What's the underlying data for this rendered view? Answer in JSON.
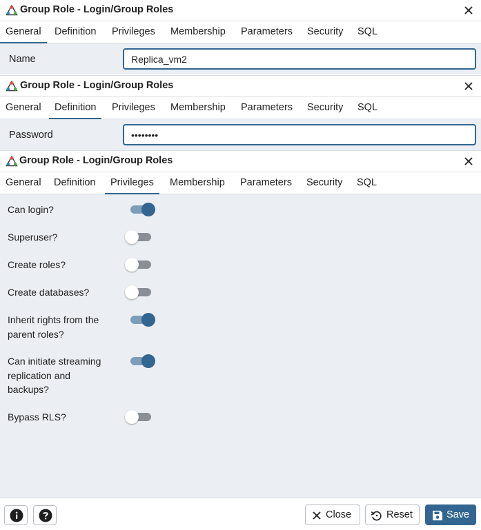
{
  "dialog_title": "Group Role - Login/Group Roles",
  "tabs": [
    "General",
    "Definition",
    "Privileges",
    "Membership",
    "Parameters",
    "Security",
    "SQL"
  ],
  "general": {
    "name_label": "Name",
    "name_value": "Replica_vm2"
  },
  "definition": {
    "password_label": "Password",
    "password_value": "••••••••"
  },
  "privileges": [
    {
      "label": "Can login?",
      "enabled": true
    },
    {
      "label": "Superuser?",
      "enabled": false
    },
    {
      "label": "Create roles?",
      "enabled": false
    },
    {
      "label": "Create databases?",
      "enabled": false
    },
    {
      "label": "Inherit rights from the parent roles?",
      "enabled": true
    },
    {
      "label": "Can initiate streaming replication and backups?",
      "enabled": true
    },
    {
      "label": "Bypass RLS?",
      "enabled": false
    }
  ],
  "footer": {
    "close_label": "Close",
    "reset_label": "Reset",
    "save_label": "Save"
  },
  "colors": {
    "accent": "#326690",
    "panel_bg": "#ebeef3",
    "toggle_off": "#8a8f96"
  },
  "icons": [
    "pgadmin-role-icon",
    "close-icon",
    "info-icon",
    "help-icon",
    "x-icon",
    "reset-icon",
    "save-icon"
  ]
}
